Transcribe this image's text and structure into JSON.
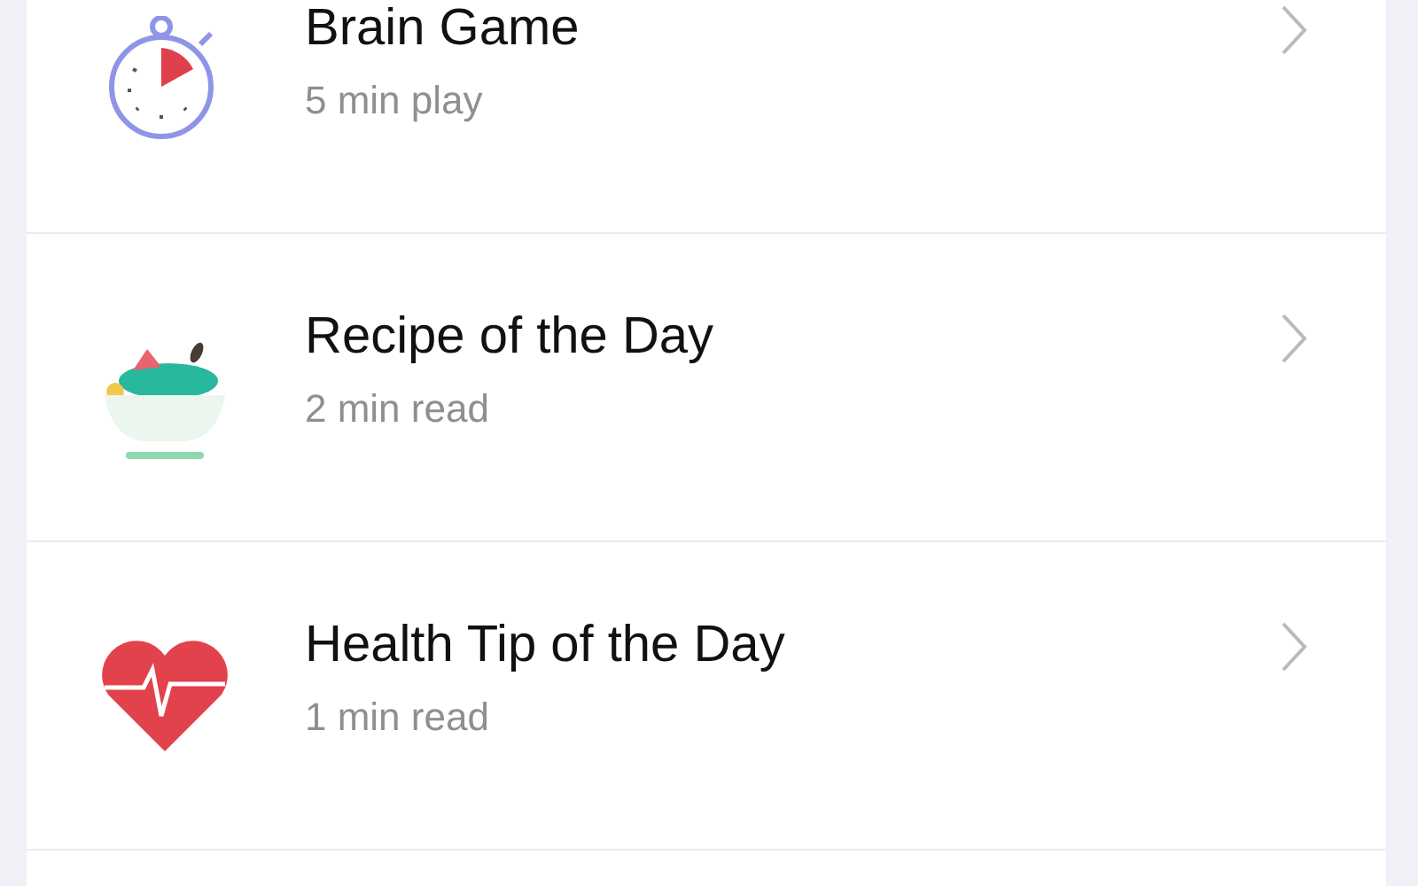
{
  "items": [
    {
      "kind": "stopwatch",
      "title": "Brain Game",
      "subtitle": "5 min play"
    },
    {
      "kind": "bowl",
      "title": "Recipe of the Day",
      "subtitle": "2 min read"
    },
    {
      "kind": "heart",
      "title": "Health Tip of the Day",
      "subtitle": "1 min read"
    }
  ]
}
